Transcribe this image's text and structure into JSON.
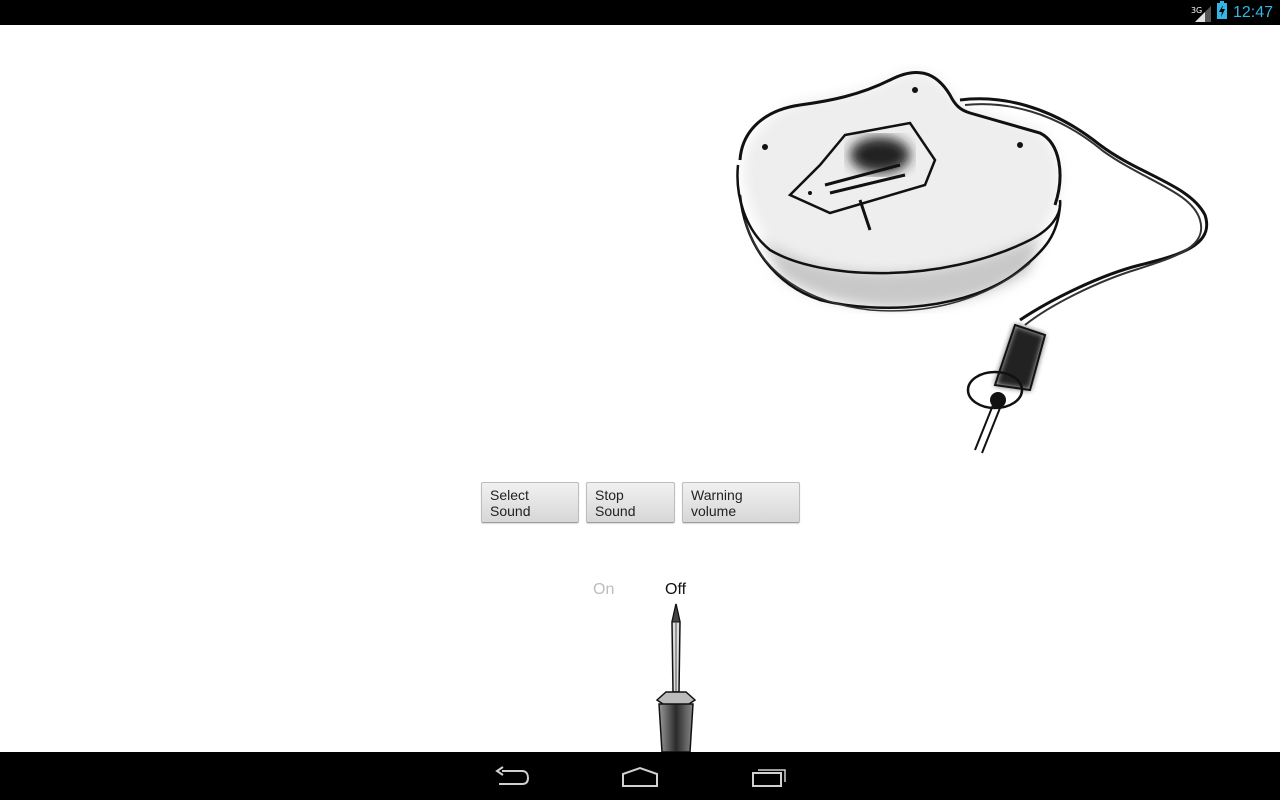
{
  "status_bar": {
    "network": "3G",
    "time": "12:47",
    "clock_color": "#33b5e5",
    "icons": [
      "signal-icon",
      "battery-charging-icon"
    ]
  },
  "buttons": {
    "select_sound": "Select Sound",
    "stop_sound": "Stop Sound",
    "warning_volume": "Warning volume"
  },
  "toggle": {
    "on_label": "On",
    "off_label": "Off",
    "state": "Off"
  },
  "navigation": {
    "icons": [
      "back-icon",
      "home-icon",
      "recent-apps-icon"
    ]
  },
  "artwork": {
    "icon": "guitar-sketch-illustration"
  }
}
